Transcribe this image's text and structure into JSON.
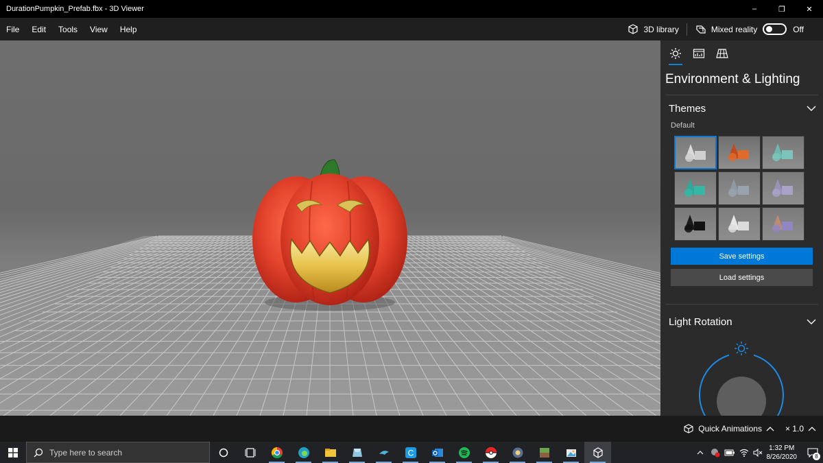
{
  "window": {
    "title": "DurationPumpkin_Prefab.fbx - 3D Viewer",
    "controls": [
      "–",
      "❐",
      "✕"
    ]
  },
  "menu": {
    "items": [
      "File",
      "Edit",
      "Tools",
      "View",
      "Help"
    ],
    "library_label": "3D library",
    "mixed_reality_label": "Mixed reality",
    "mixed_reality_state": "Off",
    "mixed_reality_on": false
  },
  "panel": {
    "tabs": [
      "sun-icon",
      "stats-icon",
      "grid-icon"
    ],
    "active_tab": 0,
    "title": "Environment & Lighting",
    "themes": {
      "heading": "Themes",
      "selected_label": "Default",
      "selected_index": 0,
      "thumbs": [
        {
          "name": "Default",
          "bg": "#7a7a7a",
          "a": "#d9d9d9",
          "b": "#cfcfcf"
        },
        {
          "name": "Warm",
          "bg": "#6f6f6f",
          "a": "#c24a1f",
          "b": "#e06a2c"
        },
        {
          "name": "Teal",
          "bg": "#767676",
          "a": "#6fb8b0",
          "b": "#7cc4bb"
        },
        {
          "name": "Green",
          "bg": "#777777",
          "a": "#2fa89a",
          "b": "#36b7a6"
        },
        {
          "name": "Slate",
          "bg": "#7a7a7a",
          "a": "#8e9aa3",
          "b": "#98a4ad"
        },
        {
          "name": "Lilac",
          "bg": "#7b7b7b",
          "a": "#9a93b8",
          "b": "#a9a2c6"
        },
        {
          "name": "Dark",
          "bg": "#787878",
          "a": "#1b1b1b",
          "b": "#111111"
        },
        {
          "name": "White",
          "bg": "#7d7d7d",
          "a": "#e7e7e7",
          "b": "#dcdcdc"
        },
        {
          "name": "Sunset",
          "bg": "#7a7a7a",
          "a": "#c08a6c",
          "b": "#8f86c2"
        }
      ]
    },
    "save_label": "Save settings",
    "load_label": "Load settings",
    "light_rotation_heading": "Light Rotation"
  },
  "bottom": {
    "quick_animations_label": "Quick Animations",
    "speed_label": "× 1.0"
  },
  "taskbar": {
    "search_placeholder": "Type here to search",
    "apps": [
      "cortana-icon",
      "task-view-icon",
      "chrome-icon",
      "edge-icon",
      "file-explorer-icon",
      "cube-app-icon",
      "dolphin-icon",
      "c-app-icon",
      "outlook-icon",
      "spotify-icon",
      "pokeball-icon",
      "gear-app-icon",
      "minecraft-icon",
      "photo-icon",
      "3d-viewer-icon"
    ],
    "time": "1:32 PM",
    "date": "8/26/2020",
    "notification_count": "8"
  },
  "colors": {
    "accent": "#0078d7",
    "panel_bg": "#2b2b2b",
    "pumpkin": "#e0402a"
  }
}
